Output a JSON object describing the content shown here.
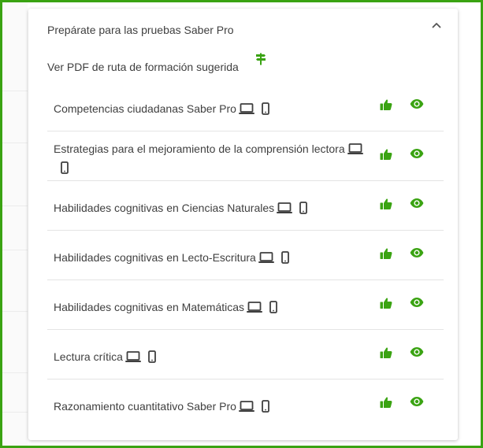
{
  "colors": {
    "accent": "#3aa312",
    "text": "#3f3f3f",
    "icon": "#3f3f3f"
  },
  "section": {
    "title": "Prepárate para las pruebas Saber Pro",
    "pdf_link": "Ver PDF de ruta de formación sugerida",
    "collapse_icon": "chevron-up-icon",
    "pdf_icon": "signpost-icon"
  },
  "courses": [
    {
      "title": "Competencias ciudadanas Saber Pro"
    },
    {
      "title": "Estrategias para el mejoramiento de la comprensión lectora"
    },
    {
      "title": "Habilidades cognitivas en Ciencias Naturales"
    },
    {
      "title": "Habilidades cognitivas en Lecto-Escritura"
    },
    {
      "title": "Habilidades cognitivas en Matemáticas"
    },
    {
      "title": "Lectura crítica"
    },
    {
      "title": "Razonamiento cuantitativo Saber Pro"
    }
  ],
  "row_icons": [
    "laptop-icon",
    "smartphone-icon",
    "thumbs-up-icon",
    "eye-icon"
  ]
}
